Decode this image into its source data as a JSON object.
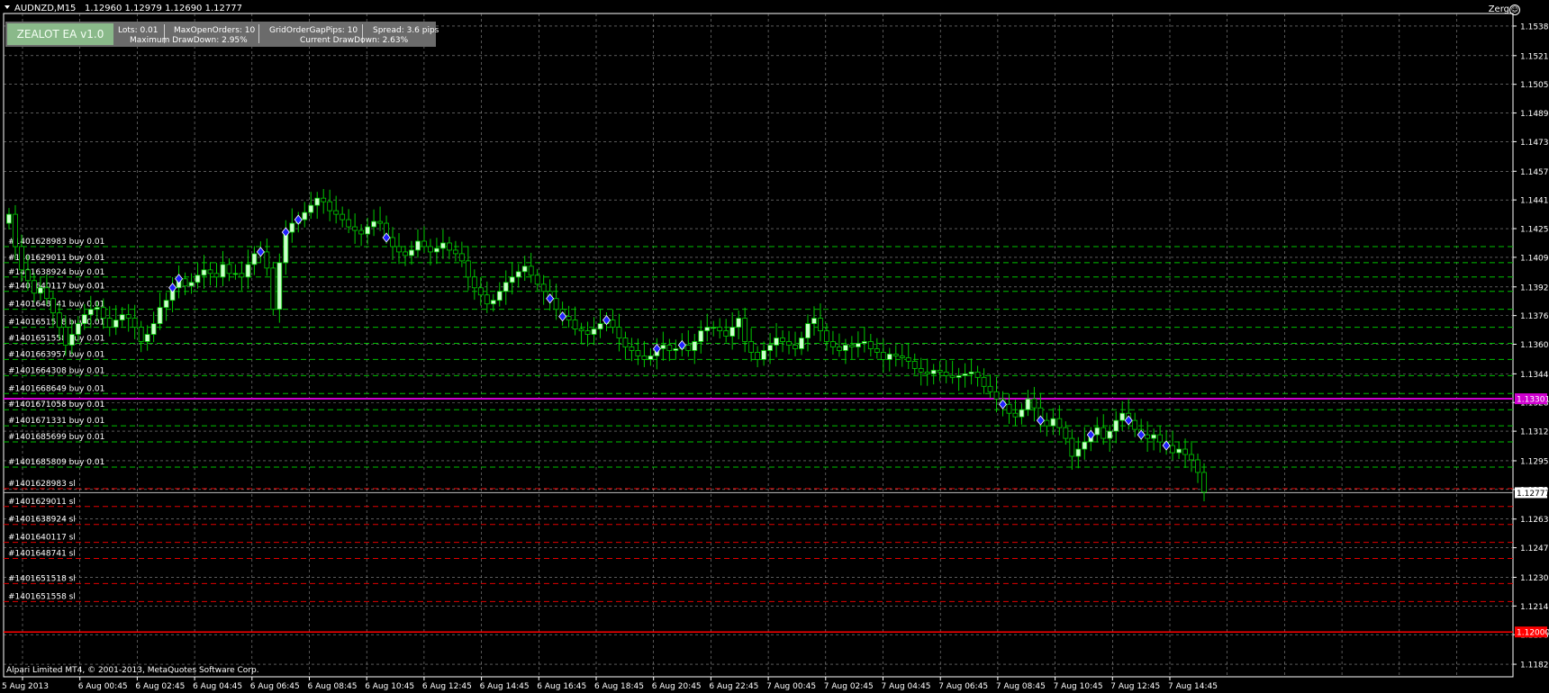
{
  "header": {
    "symbol": "AUDNZD,M15",
    "ohlc": "1.12960 1.12979 1.12690 1.12777",
    "profile_label": "Zerg"
  },
  "ea_panel": {
    "title": "ZEALOT EA v1.0",
    "lots": "Lots: 0.01",
    "max_open_orders": "MaxOpenOrders: 10",
    "grid_gap": "GridOrderGapPips: 10",
    "spread": "Spread: 3.6 pips",
    "max_drawdown": "Maximum DrawDown: 2.95%",
    "current_drawdown": "Current DrawDown: 2.63%"
  },
  "footer": {
    "copyright": "Alpari Limited MT4, © 2001-2013, MetaQuotes Software Corp."
  },
  "colors": {
    "background": "#000000",
    "grid": "#c0c0c0",
    "bull_candle": "#ccffcc",
    "candle_wick": "#00cc00",
    "buy_line": "#00c000",
    "sl_line": "#e00000",
    "target_line": "#d000d0",
    "marker": "#2020ff"
  },
  "price_axis": {
    "ticks": [
      "1.15380",
      "1.15215",
      "1.15055",
      "1.14895",
      "1.14735",
      "1.14570",
      "1.14410",
      "1.14250",
      "1.14090",
      "1.13925",
      "1.13765",
      "1.13605",
      "1.13440",
      "1.13280",
      "1.13120",
      "1.12955",
      "1.12795",
      "1.12630",
      "1.12470",
      "1.12305",
      "1.12145",
      "1.11985",
      "1.11820"
    ],
    "bid_label": "1.12777",
    "magenta_label": "1.13301",
    "red_label": "1.12000"
  },
  "time_axis": {
    "labels": [
      "5 Aug 2013",
      "6 Aug 00:45",
      "6 Aug 02:45",
      "6 Aug 04:45",
      "6 Aug 06:45",
      "6 Aug 08:45",
      "6 Aug 10:45",
      "6 Aug 12:45",
      "6 Aug 14:45",
      "6 Aug 16:45",
      "6 Aug 18:45",
      "6 Aug 20:45",
      "6 Aug 22:45",
      "7 Aug 00:45",
      "7 Aug 02:45",
      "7 Aug 04:45",
      "7 Aug 06:45",
      "7 Aug 08:45",
      "7 Aug 10:45",
      "7 Aug 12:45",
      "7 Aug 14:45"
    ]
  },
  "order_lines": {
    "buy": [
      {
        "label": "#1401628983 buy 0.01",
        "price": 1.1415
      },
      {
        "label": "#1401629011 buy 0.01",
        "price": 1.1406
      },
      {
        "label": "#1401638924 buy 0.01",
        "price": 1.1398
      },
      {
        "label": "#1401640117 buy 0.01",
        "price": 1.139
      },
      {
        "label": "#1401648741 buy 0.01",
        "price": 1.138
      },
      {
        "label": "#1401651518 buy 0.01",
        "price": 1.137
      },
      {
        "label": "#1401651558 buy 0.01",
        "price": 1.1361
      },
      {
        "label": "#1401663957 buy 0.01",
        "price": 1.1352
      },
      {
        "label": "#1401664308 buy 0.01",
        "price": 1.1343
      },
      {
        "label": "#1401668649 buy 0.01",
        "price": 1.1333
      },
      {
        "label": "#1401671058 buy 0.01",
        "price": 1.1324
      },
      {
        "label": "#1401671331 buy 0.01",
        "price": 1.1315
      },
      {
        "label": "#1401685699 buy 0.01",
        "price": 1.1306
      },
      {
        "label": "#1401685809 buy 0.01",
        "price": 1.1292
      }
    ],
    "sl": [
      {
        "label": "#1401628983 sl",
        "price": 1.128
      },
      {
        "label": "#1401629011 sl",
        "price": 1.127
      },
      {
        "label": "#1401638924 sl",
        "price": 1.126
      },
      {
        "label": "#1401640117 sl",
        "price": 1.125
      },
      {
        "label": "#1401648741 sl",
        "price": 1.1241
      },
      {
        "label": "#1401651518 sl",
        "price": 1.1227
      },
      {
        "label": "#1401651558 sl",
        "price": 1.1217
      }
    ]
  },
  "chart_data": {
    "type": "candlestick",
    "symbol": "AUDNZD",
    "timeframe": "M15",
    "ylim": [
      1.1175,
      1.1545
    ],
    "close": [
      1.1433,
      1.1415,
      1.1402,
      1.1396,
      1.1389,
      1.1392,
      1.1386,
      1.1378,
      1.137,
      1.136,
      1.1366,
      1.1372,
      1.1377,
      1.138,
      1.1381,
      1.1375,
      1.137,
      1.1374,
      1.1377,
      1.1375,
      1.137,
      1.1362,
      1.1366,
      1.1372,
      1.1381,
      1.1385,
      1.1392,
      1.1397,
      1.1393,
      1.1395,
      1.1399,
      1.1402,
      1.14,
      1.1398,
      1.1405,
      1.14,
      1.14,
      1.1398,
      1.1405,
      1.1411,
      1.1412,
      1.1403,
      1.138,
      1.1406,
      1.1423,
      1.1428,
      1.143,
      1.1434,
      1.1438,
      1.1442,
      1.144,
      1.1435,
      1.1433,
      1.143,
      1.1426,
      1.1424,
      1.1422,
      1.1426,
      1.1429,
      1.1428,
      1.142,
      1.1415,
      1.1412,
      1.141,
      1.1413,
      1.1418,
      1.1415,
      1.1412,
      1.1414,
      1.1417,
      1.1413,
      1.1411,
      1.1407,
      1.1398,
      1.1392,
      1.1388,
      1.1383,
      1.1385,
      1.139,
      1.1395,
      1.1398,
      1.1401,
      1.1404,
      1.1399,
      1.1394,
      1.139,
      1.1386,
      1.138,
      1.1376,
      1.1374,
      1.1369,
      1.1368,
      1.1366,
      1.1369,
      1.1372,
      1.1374,
      1.137,
      1.1364,
      1.1359,
      1.1357,
      1.1354,
      1.1352,
      1.1354,
      1.1358,
      1.136,
      1.1357,
      1.1358,
      1.136,
      1.1357,
      1.1362,
      1.1368,
      1.137,
      1.137,
      1.1368,
      1.1365,
      1.137,
      1.1375,
      1.1362,
      1.1356,
      1.1352,
      1.1357,
      1.136,
      1.1364,
      1.1362,
      1.136,
      1.1358,
      1.1364,
      1.1372,
      1.1375,
      1.1368,
      1.1362,
      1.1359,
      1.1357,
      1.136,
      1.1359,
      1.1361,
      1.1362,
      1.1358,
      1.1356,
      1.1352,
      1.1355,
      1.1354,
      1.1353,
      1.1351,
      1.1347,
      1.1345,
      1.1344,
      1.1346,
      1.1345,
      1.1343,
      1.1342,
      1.1343,
      1.1344,
      1.1345,
      1.1342,
      1.1337,
      1.1334,
      1.133,
      1.1327,
      1.1322,
      1.132,
      1.1324,
      1.133,
      1.1325,
      1.1318,
      1.1315,
      1.1319,
      1.1314,
      1.1308,
      1.1298,
      1.1302,
      1.1306,
      1.131,
      1.1314,
      1.1308,
      1.1312,
      1.1318,
      1.1322,
      1.1318,
      1.1313,
      1.131,
      1.1308,
      1.131,
      1.1306,
      1.1304,
      1.13,
      1.1302,
      1.1299,
      1.1296,
      1.1289,
      1.1278
    ]
  }
}
